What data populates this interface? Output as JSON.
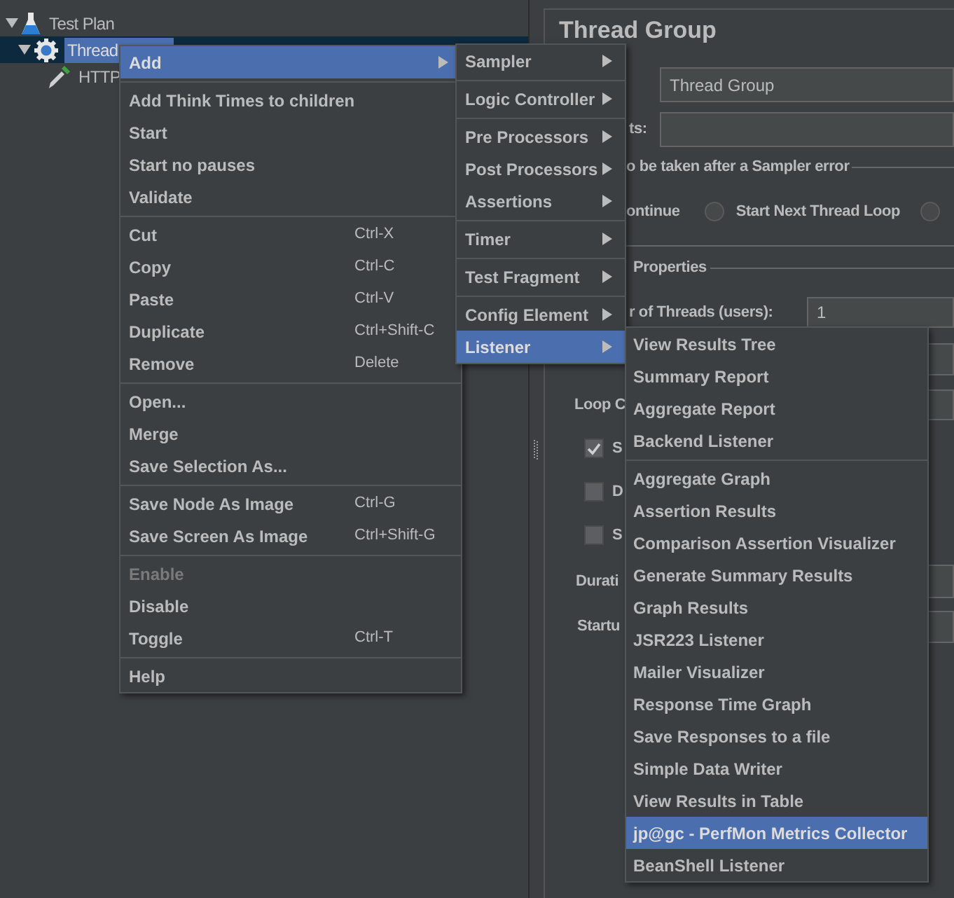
{
  "tree": [
    {
      "label": "Test Plan",
      "kind": "plan",
      "expanded": true,
      "selected": false,
      "children": [
        {
          "label": "Thread",
          "kind": "thread-group",
          "expanded": true,
          "selected": true,
          "children": [
            {
              "label": "HTTP",
              "kind": "sampler",
              "selected": false
            }
          ]
        }
      ]
    }
  ],
  "panel": {
    "title": "Thread Group",
    "name_value": "Thread Group",
    "comments_label": "ts:",
    "error_legend": "o be taken after a Sampler error",
    "error_options": [
      {
        "label": "ontinue"
      },
      {
        "label": "Start Next Thread Loop",
        "selected": false
      },
      {
        "selected": false
      }
    ],
    "properties_legend": "Properties",
    "threads_label": "r of Threads (users):",
    "threads_value": "1",
    "loop_label": "Loop C",
    "checkboxes": [
      {
        "label": "S",
        "checked": true
      },
      {
        "label": "D",
        "checked": false
      },
      {
        "label": "S",
        "checked": false
      }
    ],
    "duration_label": "Durati",
    "startup_label": "Startu"
  },
  "context_menu": {
    "groups": [
      [
        {
          "label": "Add",
          "kind": "submenu",
          "selected": true
        }
      ],
      [
        {
          "label": "Add Think Times to children",
          "kind": "command",
          "selected": false,
          "disabled": false
        },
        {
          "label": "Start",
          "kind": "command",
          "selected": false,
          "disabled": false
        },
        {
          "label": "Start no pauses",
          "kind": "command",
          "selected": false,
          "disabled": false
        },
        {
          "label": "Validate",
          "kind": "command",
          "selected": false,
          "disabled": false
        }
      ],
      [
        {
          "label": "Cut",
          "shortcut": "Ctrl-X",
          "kind": "command",
          "selected": false,
          "disabled": false
        },
        {
          "label": "Copy",
          "shortcut": "Ctrl-C",
          "kind": "command",
          "selected": false,
          "disabled": false
        },
        {
          "label": "Paste",
          "shortcut": "Ctrl-V",
          "kind": "command",
          "selected": false,
          "disabled": false
        },
        {
          "label": "Duplicate",
          "shortcut": "Ctrl+Shift-C",
          "kind": "command",
          "selected": false,
          "disabled": false
        },
        {
          "label": "Remove",
          "shortcut": "Delete",
          "kind": "command",
          "selected": false,
          "disabled": false
        }
      ],
      [
        {
          "label": "Open...",
          "kind": "command",
          "selected": false,
          "disabled": false
        },
        {
          "label": "Merge",
          "kind": "command",
          "selected": false,
          "disabled": false
        },
        {
          "label": "Save Selection As...",
          "kind": "command",
          "selected": false,
          "disabled": false
        }
      ],
      [
        {
          "label": "Save Node As Image",
          "shortcut": "Ctrl-G",
          "kind": "command",
          "selected": false,
          "disabled": false
        },
        {
          "label": "Save Screen As Image",
          "shortcut": "Ctrl+Shift-G",
          "kind": "command",
          "selected": false,
          "disabled": false
        }
      ],
      [
        {
          "label": "Enable",
          "kind": "command",
          "selected": false,
          "disabled": true
        },
        {
          "label": "Disable",
          "kind": "command",
          "selected": false,
          "disabled": false
        },
        {
          "label": "Toggle",
          "shortcut": "Ctrl-T",
          "kind": "command",
          "selected": false,
          "disabled": false
        }
      ],
      [
        {
          "label": "Help",
          "kind": "command",
          "selected": false,
          "disabled": false
        }
      ]
    ]
  },
  "add_submenu": {
    "groups": [
      [
        {
          "label": "Sampler",
          "kind": "submenu",
          "selected": false
        }
      ],
      [
        {
          "label": "Logic Controller",
          "kind": "submenu",
          "selected": false
        }
      ],
      [
        {
          "label": "Pre Processors",
          "kind": "submenu",
          "selected": false
        },
        {
          "label": "Post Processors",
          "kind": "submenu",
          "selected": false
        },
        {
          "label": "Assertions",
          "kind": "submenu",
          "selected": false
        }
      ],
      [
        {
          "label": "Timer",
          "kind": "submenu",
          "selected": false
        }
      ],
      [
        {
          "label": "Test Fragment",
          "kind": "submenu",
          "selected": false
        }
      ],
      [
        {
          "label": "Config Element",
          "kind": "submenu",
          "selected": false
        },
        {
          "label": "Listener",
          "kind": "submenu",
          "selected": true
        }
      ]
    ]
  },
  "listener_submenu": {
    "groups": [
      [
        {
          "label": "View Results Tree",
          "kind": "command",
          "selected": false
        },
        {
          "label": "Summary Report",
          "kind": "command",
          "selected": false
        },
        {
          "label": "Aggregate Report",
          "kind": "command",
          "selected": false
        },
        {
          "label": "Backend Listener",
          "kind": "command",
          "selected": false
        }
      ],
      [
        {
          "label": "Aggregate Graph",
          "kind": "command",
          "selected": false
        },
        {
          "label": "Assertion Results",
          "kind": "command",
          "selected": false
        },
        {
          "label": "Comparison Assertion Visualizer",
          "kind": "command",
          "selected": false
        },
        {
          "label": "Generate Summary Results",
          "kind": "command",
          "selected": false
        },
        {
          "label": "Graph Results",
          "kind": "command",
          "selected": false
        },
        {
          "label": "JSR223 Listener",
          "kind": "command",
          "selected": false
        },
        {
          "label": "Mailer Visualizer",
          "kind": "command",
          "selected": false
        },
        {
          "label": "Response Time Graph",
          "kind": "command",
          "selected": false
        },
        {
          "label": "Save Responses to a file",
          "kind": "command",
          "selected": false
        },
        {
          "label": "Simple Data Writer",
          "kind": "command",
          "selected": false
        },
        {
          "label": "View Results in Table",
          "kind": "command",
          "selected": false
        },
        {
          "label": "jp@gc - PerfMon Metrics Collector",
          "kind": "command",
          "selected": true
        },
        {
          "label": "BeanShell Listener",
          "kind": "command",
          "selected": false
        }
      ]
    ]
  }
}
